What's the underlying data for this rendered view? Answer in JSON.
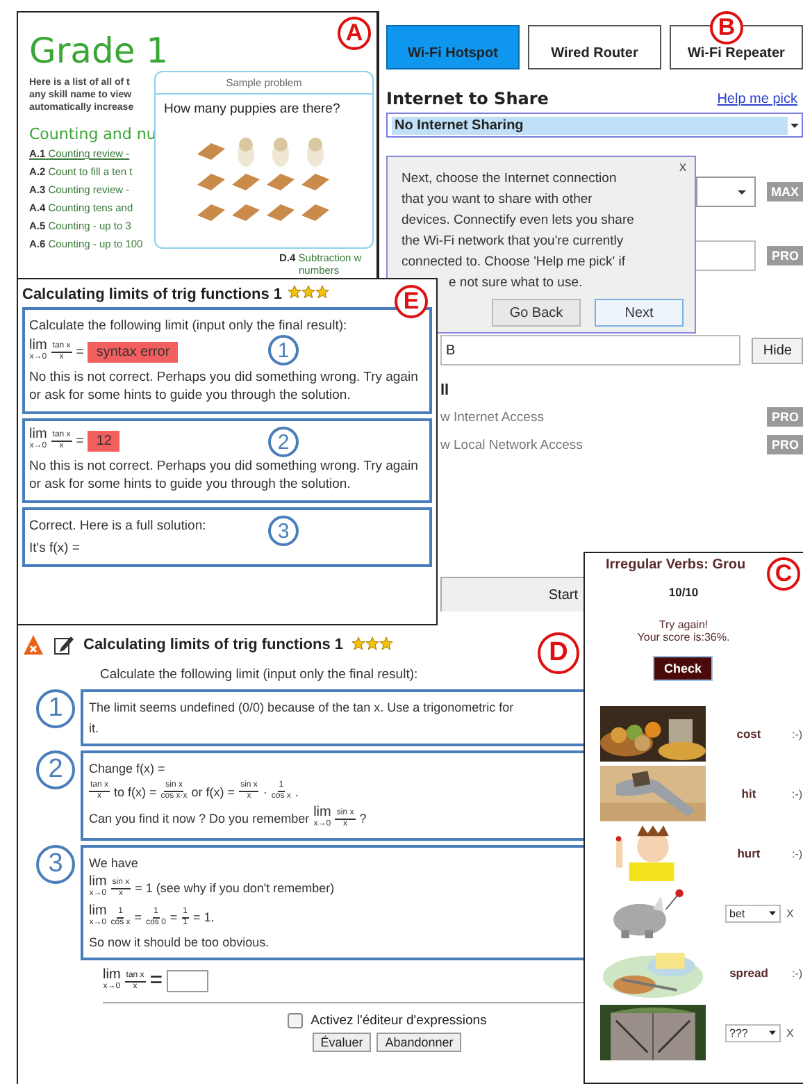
{
  "grade_page": {
    "marker": "A",
    "title": "Grade 1",
    "intro_lines": [
      "Here is a list of all of t",
      "any skill name to view",
      "automatically increase"
    ],
    "section": "Counting and nu",
    "skills": [
      {
        "code": "A.1",
        "name": "Counting review -",
        "hovered": true
      },
      {
        "code": "A.2",
        "name": "Count to fill a ten t",
        "hovered": false
      },
      {
        "code": "A.3",
        "name": "Counting review -",
        "hovered": false
      },
      {
        "code": "A.4",
        "name": "Counting tens and",
        "hovered": false
      },
      {
        "code": "A.5",
        "name": "Counting - up to 3",
        "hovered": false
      },
      {
        "code": "A.6",
        "name": "Counting - up to 100",
        "hovered": false
      }
    ],
    "side_skill": {
      "code": "D.4",
      "name": "Subtraction w",
      "name_2": "numbers"
    },
    "popup": {
      "header": "Sample problem",
      "question": "How many puppies are there?"
    }
  },
  "connectify": {
    "marker": "B",
    "tabs": [
      {
        "label": "Wi-Fi Hotspot",
        "selected": true
      },
      {
        "label": "Wired Router",
        "selected": false
      },
      {
        "label": "Wi-Fi Repeater",
        "selected": false
      }
    ],
    "share_label": "Internet to Share",
    "help_link": "Help me pick",
    "share_select": "No Internet Sharing",
    "tooltip": {
      "close": "x",
      "lines": [
        "Next, choose the Internet connection",
        "that you want to share with other",
        "devices.  Connectify even lets you share",
        "the Wi-Fi network that you're currently",
        "connected to. Choose 'Help me pick' if"
      ],
      "last_line": "e not sure what to use.",
      "buttons": [
        {
          "label": "Go Back",
          "selected": false
        },
        {
          "label": "Next",
          "selected": true
        }
      ]
    },
    "max_badge": "MAX",
    "pro_badge": "PRO",
    "field_value": "B",
    "hide_button": "Hide",
    "section": "ll",
    "options": [
      {
        "label": "w Internet Access",
        "badge": "PRO"
      },
      {
        "label": "w Local Network Access",
        "badge": "PRO"
      }
    ],
    "start_button": "Start"
  },
  "exercise_e": {
    "marker": "E",
    "title": "Calculating limits of trig functions 1",
    "stars": 3,
    "attempts": [
      {
        "number": "1",
        "lines": [
          [
            {
              "kind": "text",
              "text": "Calculate the following limit (input only the final result):"
            }
          ],
          [
            {
              "kind": "lim",
              "sub": "x→0"
            },
            {
              "kind": "frac",
              "num": "tan x",
              "den": "x"
            },
            {
              "kind": "text",
              "text": "="
            },
            {
              "kind": "answer",
              "text": "syntax error",
              "correct": false
            }
          ],
          [
            {
              "kind": "text",
              "text": "No this is not correct. Perhaps you did something wrong. Try again or ask for some hints to guide you through the solution."
            }
          ]
        ]
      },
      {
        "number": "2",
        "lines": [
          [
            {
              "kind": "lim",
              "sub": "x→0"
            },
            {
              "kind": "frac",
              "num": "tan x",
              "den": "x"
            },
            {
              "kind": "text",
              "text": "="
            },
            {
              "kind": "answer",
              "text": "12",
              "correct": false
            }
          ],
          [
            {
              "kind": "text",
              "text": "No this is not correct. Perhaps you did something wrong. Try again or ask for some hints to guide you through the solution."
            }
          ]
        ]
      },
      {
        "number": "3",
        "lines": [
          [
            {
              "kind": "text",
              "text": "Correct. Here is a full solution:"
            }
          ],
          [
            {
              "kind": "text",
              "text": "It's f(x) ="
            }
          ]
        ]
      }
    ]
  },
  "verbs": {
    "marker": "C",
    "title": "Irregular Verbs: Grou",
    "score": "10/10",
    "feedback_lines": [
      "Try again!",
      "Your score is:36%."
    ],
    "check_button": "Check",
    "rows": [
      {
        "kind": "word",
        "word": "cost",
        "mark": ":-)"
      },
      {
        "kind": "word",
        "word": "hit",
        "mark": ":-)"
      },
      {
        "kind": "word",
        "word": "hurt",
        "mark": ":-)"
      },
      {
        "kind": "select",
        "value": "bet",
        "mark": "X"
      },
      {
        "kind": "word",
        "word": "spread",
        "mark": ":-)"
      },
      {
        "kind": "select",
        "value": "???",
        "mark": "X"
      }
    ]
  },
  "exercise_d": {
    "marker": "D",
    "title": "Calculating limits of trig functions 1",
    "stars": 3,
    "prompt": "Calculate the following limit (input only the final result):",
    "hints": [
      {
        "number": "1",
        "lines": [
          [
            {
              "kind": "text",
              "text": "The limit seems undefined (0/0) because of the tan x. Use a trigonometric for"
            }
          ],
          [
            {
              "kind": "text",
              "text": "it."
            }
          ]
        ]
      },
      {
        "number": "2",
        "lines": [
          [
            {
              "kind": "text",
              "text": "Change f(x) ="
            }
          ],
          [
            {
              "kind": "frac",
              "num": "tan x",
              "den": "x"
            },
            {
              "kind": "text",
              "text": "to f(x) ="
            },
            {
              "kind": "frac",
              "num": "sin x",
              "den": "cos x·x"
            },
            {
              "kind": "text",
              "text": "or f(x) ="
            },
            {
              "kind": "frac",
              "num": "sin x",
              "den": "x"
            },
            {
              "kind": "text",
              "text": "·"
            },
            {
              "kind": "frac",
              "num": "1",
              "den": "cos x"
            },
            {
              "kind": "text",
              "text": "."
            }
          ],
          [
            {
              "kind": "text",
              "text": "Can you find it now ? Do you remember"
            },
            {
              "kind": "lim",
              "sub": "x→0"
            },
            {
              "kind": "frac",
              "num": "sin x",
              "den": "x"
            },
            {
              "kind": "text",
              "text": "?"
            }
          ]
        ]
      },
      {
        "number": "3",
        "lines": [
          [
            {
              "kind": "text",
              "text": "We have"
            }
          ],
          [
            {
              "kind": "lim",
              "sub": "x→0"
            },
            {
              "kind": "frac",
              "num": "sin x",
              "den": "x"
            },
            {
              "kind": "text",
              "text": "= 1 (see why if you don't remember)"
            }
          ],
          [
            {
              "kind": "lim",
              "sub": "x→0"
            },
            {
              "kind": "frac",
              "num": "1",
              "den": "cos x"
            },
            {
              "kind": "text",
              "text": "="
            },
            {
              "kind": "frac",
              "num": "1",
              "den": "cos 0"
            },
            {
              "kind": "text",
              "text": "="
            },
            {
              "kind": "frac",
              "num": "1",
              "den": "1"
            },
            {
              "kind": "text",
              "text": "= 1."
            }
          ],
          [
            {
              "kind": "text",
              "text": "So now it should be too obvious."
            }
          ]
        ]
      }
    ],
    "answer": [
      {
        "kind": "lim",
        "sub": "x→0"
      },
      {
        "kind": "frac",
        "num": "tan x",
        "den": "x"
      },
      {
        "kind": "text",
        "text": "="
      },
      {
        "kind": "input"
      }
    ],
    "editor_toggle": {
      "label": "Activez l'éditeur d'expressions",
      "checked": false
    },
    "buttons": [
      "Évaluer",
      "Abandonner"
    ]
  }
}
